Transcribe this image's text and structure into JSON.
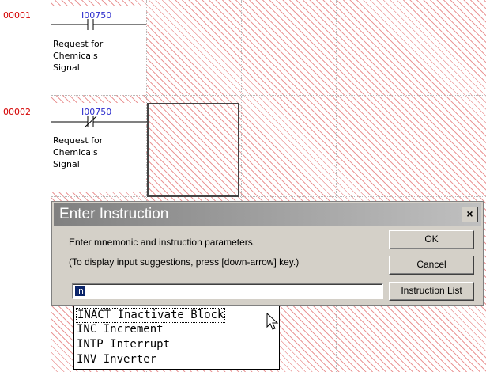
{
  "rungs": [
    {
      "number": "00001",
      "address": "I00750",
      "comment": [
        "Request for",
        "Chemicals",
        "Signal"
      ]
    },
    {
      "number": "00002",
      "address": "I00750",
      "comment": [
        "Request for",
        "Chemicals",
        "Signal"
      ]
    }
  ],
  "dialog": {
    "title": "Enter Instruction",
    "close_label": "×",
    "line1": "Enter mnemonic and instruction parameters.",
    "line2": "(To display input suggestions, press [down-arrow] key.)",
    "input_value": "in",
    "ok_label": "OK",
    "cancel_label": "Cancel",
    "list_label": "Instruction List"
  },
  "suggestions": [
    "INACT Inactivate Block",
    "INC Increment",
    "INTP Interrupt",
    "INV Inverter"
  ],
  "colors": {
    "rung_number": "#d40000",
    "address": "#2b2bcc",
    "hatch": "#e88c8c",
    "selection": "#0a246a"
  }
}
